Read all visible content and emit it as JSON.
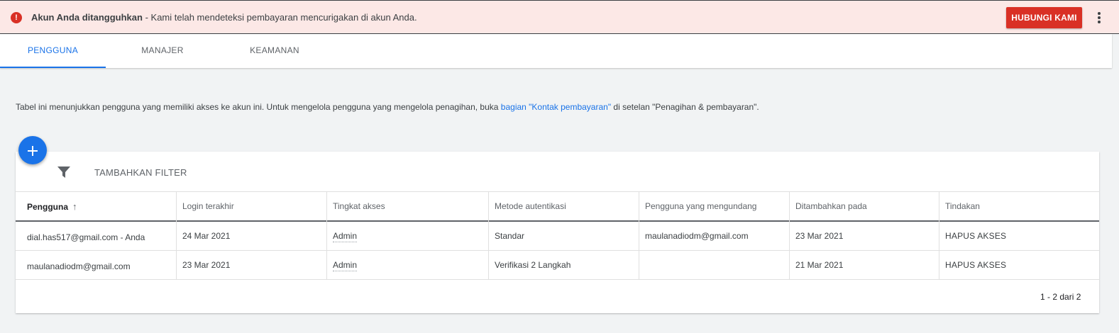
{
  "alert": {
    "title": "Akun Anda ditangguhkan",
    "message": " - Kami telah mendeteksi pembayaran mencurigakan di akun Anda.",
    "button_label": "HUBUNGI KAMI",
    "icon": "error-icon",
    "color": "#d93025"
  },
  "tabs": [
    {
      "label": "PENGGUNA",
      "active": true
    },
    {
      "label": "MANAJER",
      "active": false
    },
    {
      "label": "KEAMANAN",
      "active": false
    }
  ],
  "description": {
    "before": "Tabel ini menunjukkan pengguna yang memiliki akses ke akun ini. Untuk mengelola pengguna yang mengelola penagihan, buka ",
    "link": "bagian \"Kontak pembayaran\"",
    "after": " di setelan \"Penagihan & pembayaran\"."
  },
  "toolbar": {
    "add_icon": "plus-icon",
    "filter_icon": "filter-icon",
    "filter_label": "TAMBAHKAN FILTER"
  },
  "table": {
    "headers": [
      "Pengguna",
      "Login terakhir",
      "Tingkat akses",
      "Metode autentikasi",
      "Pengguna yang mengundang",
      "Ditambahkan pada",
      "Tindakan"
    ],
    "sort_icon": "arrow-up-icon",
    "rows": [
      [
        "dial.has517@gmail.com - Anda",
        "24 Mar 2021",
        "Admin",
        "Standar",
        "maulanadiodm@gmail.com",
        "23 Mar 2021",
        "HAPUS AKSES"
      ],
      [
        "maulanadiodm@gmail.com",
        "23 Mar 2021",
        "Admin",
        "Verifikasi 2 Langkah",
        "",
        "21 Mar 2021",
        "HAPUS AKSES"
      ]
    ]
  },
  "pagination": {
    "label": "1 - 2 dari 2"
  },
  "colors": {
    "accent": "#1a73e8",
    "alert_bg": "#fce8e6",
    "danger": "#d93025"
  }
}
